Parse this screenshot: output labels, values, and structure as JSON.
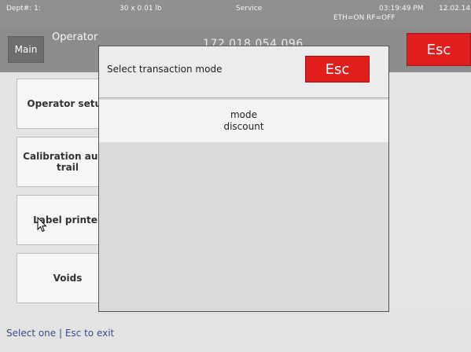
{
  "status_bar": {
    "dept": "Dept#: 1:",
    "weight": "30 x 0.01 lb",
    "mode": "Service",
    "time": "03:19:49 PM",
    "date": "12.02.14",
    "network": "ETH=ON RF=OFF"
  },
  "header": {
    "main_label": "Main",
    "title": "Operator",
    "id_text": "172.018.054.096",
    "esc_label": "Esc"
  },
  "menu": {
    "items": [
      {
        "label": "Operator setup"
      },
      {
        "label": "Calibration audit trail"
      },
      {
        "label": "Label printer"
      },
      {
        "label": "Voids"
      }
    ]
  },
  "modal": {
    "title": "Select transaction mode",
    "esc_label": "Esc",
    "options": [
      {
        "line1": "mode",
        "line2": "discount"
      }
    ]
  },
  "footer": {
    "hint": "Select one | Esc to exit"
  },
  "colors": {
    "esc_red": "#e01e1e",
    "header_gray": "#8c8c8c",
    "footer_text": "#3a4a8a"
  }
}
